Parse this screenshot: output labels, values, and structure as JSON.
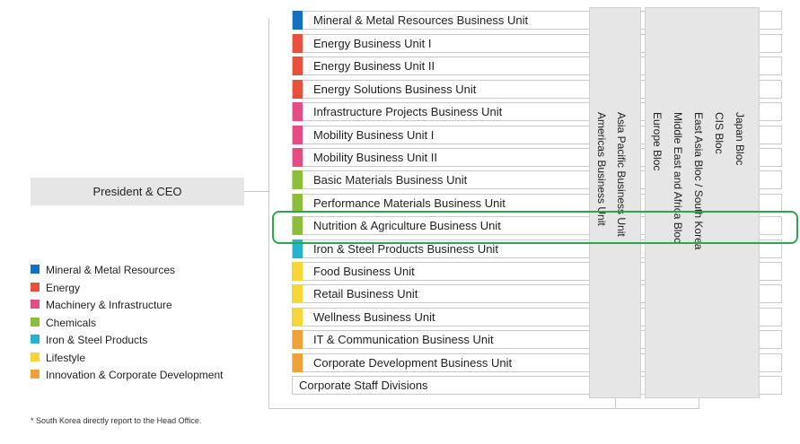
{
  "ceo": {
    "label": "President & CEO"
  },
  "colors": {
    "mineral": "#1570c1",
    "energy": "#e8503c",
    "machinery": "#e64c84",
    "chemicals": "#8cbe3c",
    "iron": "#26b3cf",
    "lifestyle": "#f7d636",
    "innovation": "#f0a23a",
    "highlight": "#2aa84a"
  },
  "units": [
    {
      "label": "Mineral & Metal Resources Business Unit",
      "color": "#1570c1"
    },
    {
      "label": "Energy Business Unit I",
      "color": "#e8503c"
    },
    {
      "label": "Energy Business Unit II",
      "color": "#e8503c"
    },
    {
      "label": "Energy Solutions Business Unit",
      "color": "#e8503c"
    },
    {
      "label": "Infrastructure Projects Business Unit",
      "color": "#e64c84"
    },
    {
      "label": "Mobility Business Unit I",
      "color": "#e64c84"
    },
    {
      "label": "Mobility Business Unit II",
      "color": "#e64c84"
    },
    {
      "label": "Basic Materials Business Unit",
      "color": "#8cbe3c"
    },
    {
      "label": "Performance Materials Business Unit",
      "color": "#8cbe3c"
    },
    {
      "label": "Nutrition & Agriculture Business Unit",
      "color": "#8cbe3c"
    },
    {
      "label": "Iron & Steel Products Business Unit",
      "color": "#26b3cf"
    },
    {
      "label": "Food Business Unit",
      "color": "#f7d636"
    },
    {
      "label": "Retail Business Unit",
      "color": "#f7d636"
    },
    {
      "label": "Wellness Business Unit",
      "color": "#f7d636"
    },
    {
      "label": "IT & Communication Business Unit",
      "color": "#f0a23a"
    },
    {
      "label": "Corporate Development Business Unit",
      "color": "#f0a23a"
    }
  ],
  "staff": {
    "label": "Corporate Staff Divisions"
  },
  "regions": {
    "col1": [
      "Americas Business Unit",
      "Asia Pacific Business Unit"
    ],
    "col2": [
      "Europe Bloc",
      "Middle East and Africa Bloc",
      "East Asia Bloc / South Korea",
      "CIS Bloc",
      "Japan Bloc"
    ]
  },
  "legend": [
    {
      "label": "Mineral & Metal Resources",
      "color": "#1570c1"
    },
    {
      "label": "Energy",
      "color": "#e8503c"
    },
    {
      "label": "Machinery & Infrastructure",
      "color": "#e64c84"
    },
    {
      "label": "Chemicals",
      "color": "#8cbe3c"
    },
    {
      "label": "Iron & Steel Products",
      "color": "#26b3cf"
    },
    {
      "label": "Lifestyle",
      "color": "#f7d636"
    },
    {
      "label": "Innovation & Corporate Development",
      "color": "#f0a23a"
    }
  ],
  "footnote": "* South Korea directly report to the Head Office."
}
